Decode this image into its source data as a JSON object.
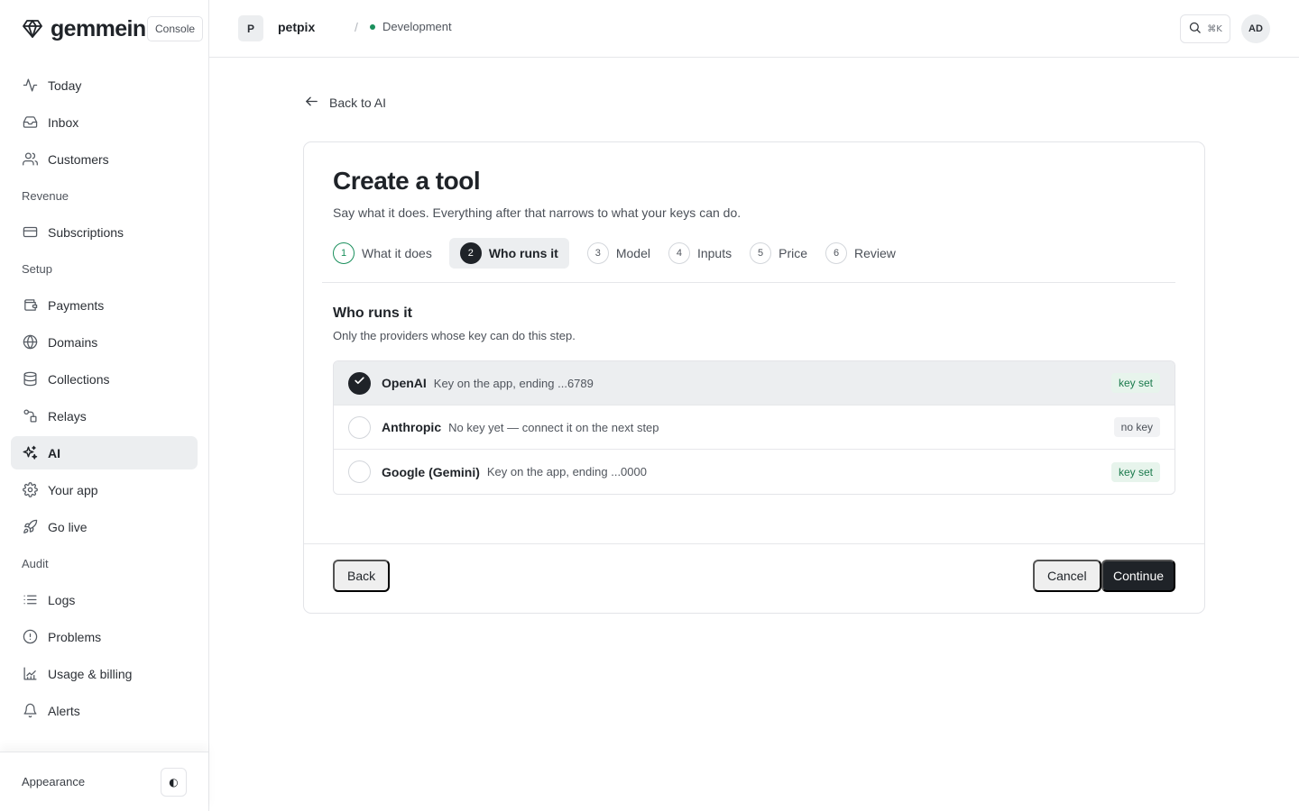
{
  "app": {
    "brand_name": "gemmein",
    "console_label": "Console"
  },
  "colors": {
    "accent_dark": "#1f2328",
    "success_green": "#1a8f5c",
    "active_bg": "#eceef0"
  },
  "sidebar": {
    "primary": [
      {
        "label": "Today",
        "icon": "activity-icon"
      },
      {
        "label": "Inbox",
        "icon": "inbox-icon"
      },
      {
        "label": "Customers",
        "icon": "users-icon"
      }
    ],
    "sections": [
      {
        "title": "Revenue",
        "items": [
          {
            "label": "Subscriptions",
            "icon": "credit-card-icon"
          }
        ]
      },
      {
        "title": "Setup",
        "items": [
          {
            "label": "Payments",
            "icon": "wallet-icon"
          },
          {
            "label": "Domains",
            "icon": "globe-icon"
          },
          {
            "label": "Collections",
            "icon": "database-icon"
          },
          {
            "label": "Relays",
            "icon": "relay-icon"
          },
          {
            "label": "AI",
            "icon": "sparkles-icon",
            "active": true
          },
          {
            "label": "Your app",
            "icon": "gear-icon"
          },
          {
            "label": "Go live",
            "icon": "rocket-icon"
          }
        ]
      },
      {
        "title": "Audit",
        "items": [
          {
            "label": "Logs",
            "icon": "list-icon"
          },
          {
            "label": "Problems",
            "icon": "alert-circle-icon"
          },
          {
            "label": "Usage & billing",
            "icon": "chart-icon"
          },
          {
            "label": "Alerts",
            "icon": "bell-icon"
          }
        ]
      }
    ],
    "footer": {
      "appearance_label": "Appearance",
      "toggle_glyph": "◐"
    }
  },
  "topbar": {
    "project_initial": "P",
    "project_name": "petpix",
    "separator": "/",
    "environment": "Development",
    "search_shortcut": "⌘K",
    "user_initials": "AD"
  },
  "main": {
    "back_link": "Back to AI",
    "title": "Create a tool",
    "subtitle": "Say what it does. Everything after that narrows to what your keys can do.",
    "steps": [
      {
        "num": "1",
        "label": "What it does",
        "state": "done"
      },
      {
        "num": "2",
        "label": "Who runs it",
        "state": "active"
      },
      {
        "num": "3",
        "label": "Model",
        "state": "todo"
      },
      {
        "num": "4",
        "label": "Inputs",
        "state": "todo"
      },
      {
        "num": "5",
        "label": "Price",
        "state": "todo"
      },
      {
        "num": "6",
        "label": "Review",
        "state": "todo"
      }
    ],
    "section_title": "Who runs it",
    "section_subtitle": "Only the providers whose key can do this step.",
    "providers": [
      {
        "name": "OpenAI",
        "desc": "Key on the app, ending ...6789",
        "badge": "key set",
        "badge_kind": "ok",
        "selected": true
      },
      {
        "name": "Anthropic",
        "desc": "No key yet — connect it on the next step",
        "badge": "no key",
        "badge_kind": "none",
        "selected": false
      },
      {
        "name": "Google (Gemini)",
        "desc": "Key on the app, ending ...0000",
        "badge": "key set",
        "badge_kind": "ok",
        "selected": false
      }
    ],
    "buttons": {
      "back": "Back",
      "cancel": "Cancel",
      "continue": "Continue"
    }
  }
}
